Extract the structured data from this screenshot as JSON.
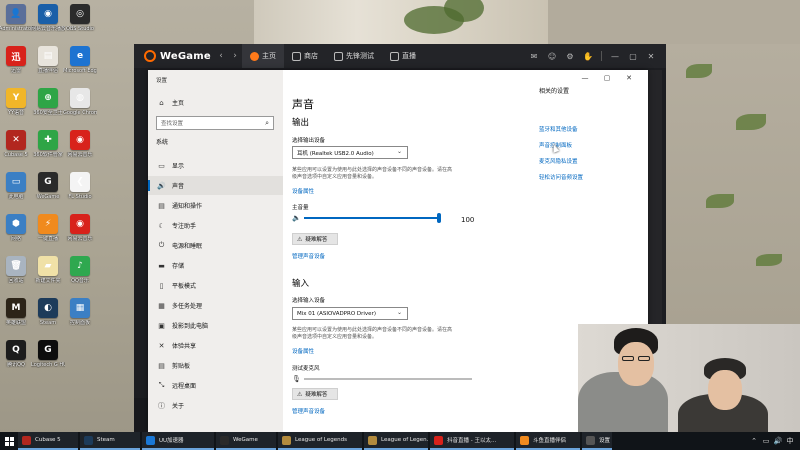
{
  "desktop_icons": [
    {
      "label": "Administrator",
      "color": "#5a6f9a",
      "glyph": "👤"
    },
    {
      "label": "网易云音乐播放器",
      "color": "#1a5fa8",
      "glyph": "◉"
    },
    {
      "label": "OBS Studio",
      "color": "#2b2b2b",
      "glyph": "◎"
    },
    {
      "label": "迅雷",
      "color": "#d8221b",
      "glyph": "迅"
    },
    {
      "label": "直播伴侣",
      "color": "#e8e4dc",
      "glyph": "▤"
    },
    {
      "label": "Microsoft Edge",
      "color": "#1d73d1",
      "glyph": "e"
    },
    {
      "label": "YY语音",
      "color": "#f1b629",
      "glyph": "Y"
    },
    {
      "label": "360安全卫士",
      "color": "#2ea546",
      "glyph": "⊕"
    },
    {
      "label": "Google Chrome",
      "color": "#e7e7e7",
      "glyph": "◍"
    },
    {
      "label": "Cubase 5",
      "color": "#b2271f",
      "glyph": "✕"
    },
    {
      "label": "360软件管家",
      "color": "#2ea546",
      "glyph": "✚"
    },
    {
      "label": "网易云音乐",
      "color": "#d8221b",
      "glyph": "◉"
    },
    {
      "label": "此电脑",
      "color": "#3b7fc4",
      "glyph": "▭"
    },
    {
      "label": "WeGame",
      "color": "#2a2a2a",
      "glyph": "G"
    },
    {
      "label": "FL Studio",
      "color": "#f4f4f4",
      "glyph": "❮"
    },
    {
      "label": "网络",
      "color": "#3b7fc4",
      "glyph": "⬢"
    },
    {
      "label": "一键直播",
      "color": "#f08a1e",
      "glyph": "⚡"
    },
    {
      "label": "网易云音乐",
      "color": "#d8221b",
      "glyph": "◉"
    },
    {
      "label": "回收站",
      "color": "#a9b4c0",
      "glyph": "🗑"
    },
    {
      "label": "新建文件夹",
      "color": "#f0e1a7",
      "glyph": "▰"
    },
    {
      "label": "QQ音乐",
      "color": "#2fa84f",
      "glyph": "♪"
    },
    {
      "label": "英雄联盟",
      "color": "#2c2418",
      "glyph": "M"
    },
    {
      "label": "Steam",
      "color": "#1d3b5a",
      "glyph": "◐"
    },
    {
      "label": "控制面板",
      "color": "#3b7fc4",
      "glyph": "▦"
    },
    {
      "label": "腾讯QQ",
      "color": "#1c1c1c",
      "glyph": "Q"
    },
    {
      "label": "Logitech G HUB",
      "color": "#0d0d0d",
      "glyph": "G"
    }
  ],
  "wegame": {
    "logo": "WeGame",
    "back": "‹",
    "forward": "›",
    "tabs": [
      "主页",
      "商店",
      "先锋测试",
      "直播"
    ],
    "right_icons": [
      "✉",
      "☺",
      "⚙",
      "✋",
      "—",
      "▢",
      "✕"
    ]
  },
  "settings": {
    "app_title": "设置",
    "home": "主页",
    "search_placeholder": "查找设置",
    "section": "系统",
    "nav": [
      {
        "label": "显示",
        "icon": "▭"
      },
      {
        "label": "声音",
        "icon": "🔊"
      },
      {
        "label": "通知和操作",
        "icon": "▤"
      },
      {
        "label": "专注助手",
        "icon": "☾"
      },
      {
        "label": "电源和睡眠",
        "icon": "⏻"
      },
      {
        "label": "存储",
        "icon": "▬"
      },
      {
        "label": "平板模式",
        "icon": "▯"
      },
      {
        "label": "多任务处理",
        "icon": "▦"
      },
      {
        "label": "投影到此电脑",
        "icon": "▣"
      },
      {
        "label": "体验共享",
        "icon": "✕"
      },
      {
        "label": "剪贴板",
        "icon": "▤"
      },
      {
        "label": "远程桌面",
        "icon": "⤡"
      },
      {
        "label": "关于",
        "icon": "ⓘ"
      }
    ],
    "window_controls": [
      "—",
      "▢",
      "✕"
    ],
    "page_title": "声音",
    "output": {
      "heading": "输出",
      "choose_label": "选择输出设备",
      "device": "耳机 (Realtek USB2.0 Audio)",
      "description": "某些应用可以设置为使用与此处选择的声音设备不同的声音设备。请在高级声音选项中自定义应用音量和设备。",
      "properties_link": "设备属性",
      "volume_label": "主音量",
      "volume": 100,
      "troubleshoot": "疑难解答",
      "manage_link": "管理声音设备"
    },
    "input": {
      "heading": "输入",
      "choose_label": "选择输入设备",
      "device": "Mix 01 (ASIOVADPRO Driver)",
      "description": "某些应用可以设置为使用与此处选择的声音设备不同的声音设备。请在高级声音选项中自定义应用音量和设备。",
      "properties_link": "设备属性",
      "test_label": "测试麦克风",
      "troubleshoot": "疑难解答",
      "manage_link": "管理声音设备"
    },
    "related": {
      "title": "相关的设置",
      "links": [
        "蓝牙和其他设备",
        "声音控制面板",
        "麦克风隐私设置",
        "轻松访问音频设置"
      ]
    }
  },
  "taskbar": {
    "items": [
      {
        "label": "Cubase 5",
        "color": "#b2271f",
        "open": true
      },
      {
        "label": "Steam",
        "color": "#1d3b5a",
        "open": true
      },
      {
        "label": "UU加速器",
        "color": "#1a78d6",
        "open": true
      },
      {
        "label": "WeGame",
        "color": "#2a2a2a",
        "open": true
      },
      {
        "label": "League of Legends",
        "color": "#b38b3d",
        "open": true
      },
      {
        "label": "League of Legen...",
        "color": "#b38b3d",
        "open": true
      },
      {
        "label": "抖音直播 - 王以太...",
        "color": "#d8221b",
        "open": true
      },
      {
        "label": "斗鱼直播伴侣",
        "color": "#f08a1e",
        "open": true
      },
      {
        "label": "设置",
        "color": "#555555",
        "open": true
      }
    ],
    "tray_icons": [
      "⌃",
      "▭",
      "🔊",
      "中"
    ]
  }
}
